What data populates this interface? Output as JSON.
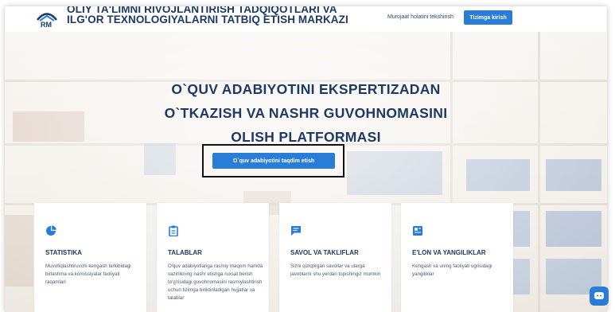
{
  "header": {
    "org_line1": "OLIY TA'LIMNI RIVOJLANTIRISH TADQIQOTLARI VA",
    "org_line2": "ILG'OR TEXNOLOGIYALARNI TATBIQ ETISH MARKAZI",
    "status_link": "Murojaat holatini tekshirish",
    "login_button": "Tizimga kirish"
  },
  "hero": {
    "line1": "O`QUV ADABIYOTINI EKSPERTIZADAN",
    "line2": "O`TKAZISH VA NASHR GUVOHNOMASINI",
    "line3": "OLISH PLATFORMASI",
    "cta": "O`quv adabiyotini taqdim etish"
  },
  "cards": [
    {
      "icon": "pie-chart-icon",
      "title": "STATISTIKA",
      "desc": "Muvofiqlashtiruvchi kengash tarkibidagi birlashma va komissiyalar faoliyati raqamlari"
    },
    {
      "icon": "clipboard-icon",
      "title": "TALABLAR",
      "desc": "O'quv adabiyotlariga rasmiy maqom hamda vazirlikning nashr etishga ruxsat berish to'g'risidagi guvohnomasini rasmiylashtirish uchun tizimga biriktiriladigan hujjatlar va talablar"
    },
    {
      "icon": "chat-icon",
      "title": "SAVOL VA TAKLIFLAR",
      "desc": "Sizni qiziqtirgan savollar va ularga javoblarni shu yerdan topishingiz mumkin"
    },
    {
      "icon": "news-icon",
      "title": "E'LON VA YANGILIKLAR",
      "desc": "Kengash va uning faoliyati ugrisidagi yangiliklar"
    }
  ],
  "colors": {
    "primary": "#2a7dd6",
    "heading": "#1c3a63"
  }
}
